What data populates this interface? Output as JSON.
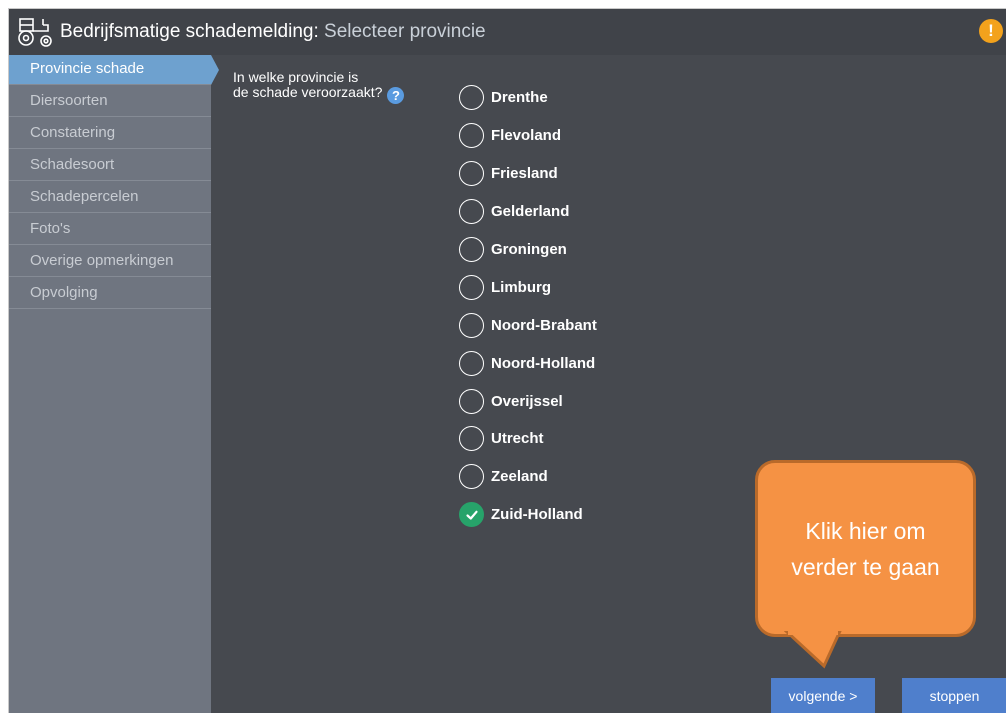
{
  "header": {
    "title": "Bedrijfsmatige schademelding",
    "separator": ":",
    "subtitle": "Selecteer provincie",
    "warning_symbol": "!",
    "logo_icon": "tractor-icon",
    "accent": "#f3a21c"
  },
  "sidebar": {
    "items": [
      {
        "label": "Provincie schade"
      },
      {
        "label": "Diersoorten"
      },
      {
        "label": "Constatering"
      },
      {
        "label": "Schadesoort"
      },
      {
        "label": "Schadepercelen"
      },
      {
        "label": "Foto's"
      },
      {
        "label": "Overige opmerkingen"
      },
      {
        "label": "Opvolging"
      }
    ],
    "active_color": "#6ea1cf"
  },
  "question": {
    "line1": "In welke provincie is",
    "line2": "de schade veroorzaakt?",
    "help_symbol": "?"
  },
  "options": [
    {
      "label": "Drenthe"
    },
    {
      "label": "Flevoland"
    },
    {
      "label": "Friesland"
    },
    {
      "label": "Gelderland"
    },
    {
      "label": "Groningen"
    },
    {
      "label": "Limburg"
    },
    {
      "label": "Noord-Brabant"
    },
    {
      "label": "Noord-Holland"
    },
    {
      "label": "Overijssel"
    },
    {
      "label": "Utrecht"
    },
    {
      "label": "Zeeland"
    },
    {
      "label": "Zuid-Holland"
    }
  ],
  "selected_option": "Zuid-Holland",
  "callout": {
    "text": "Klik hier om verder te gaan",
    "color": "#f59244"
  },
  "buttons": {
    "next": "volgende >",
    "stop": "stoppen",
    "color": "#4f7fcc"
  }
}
